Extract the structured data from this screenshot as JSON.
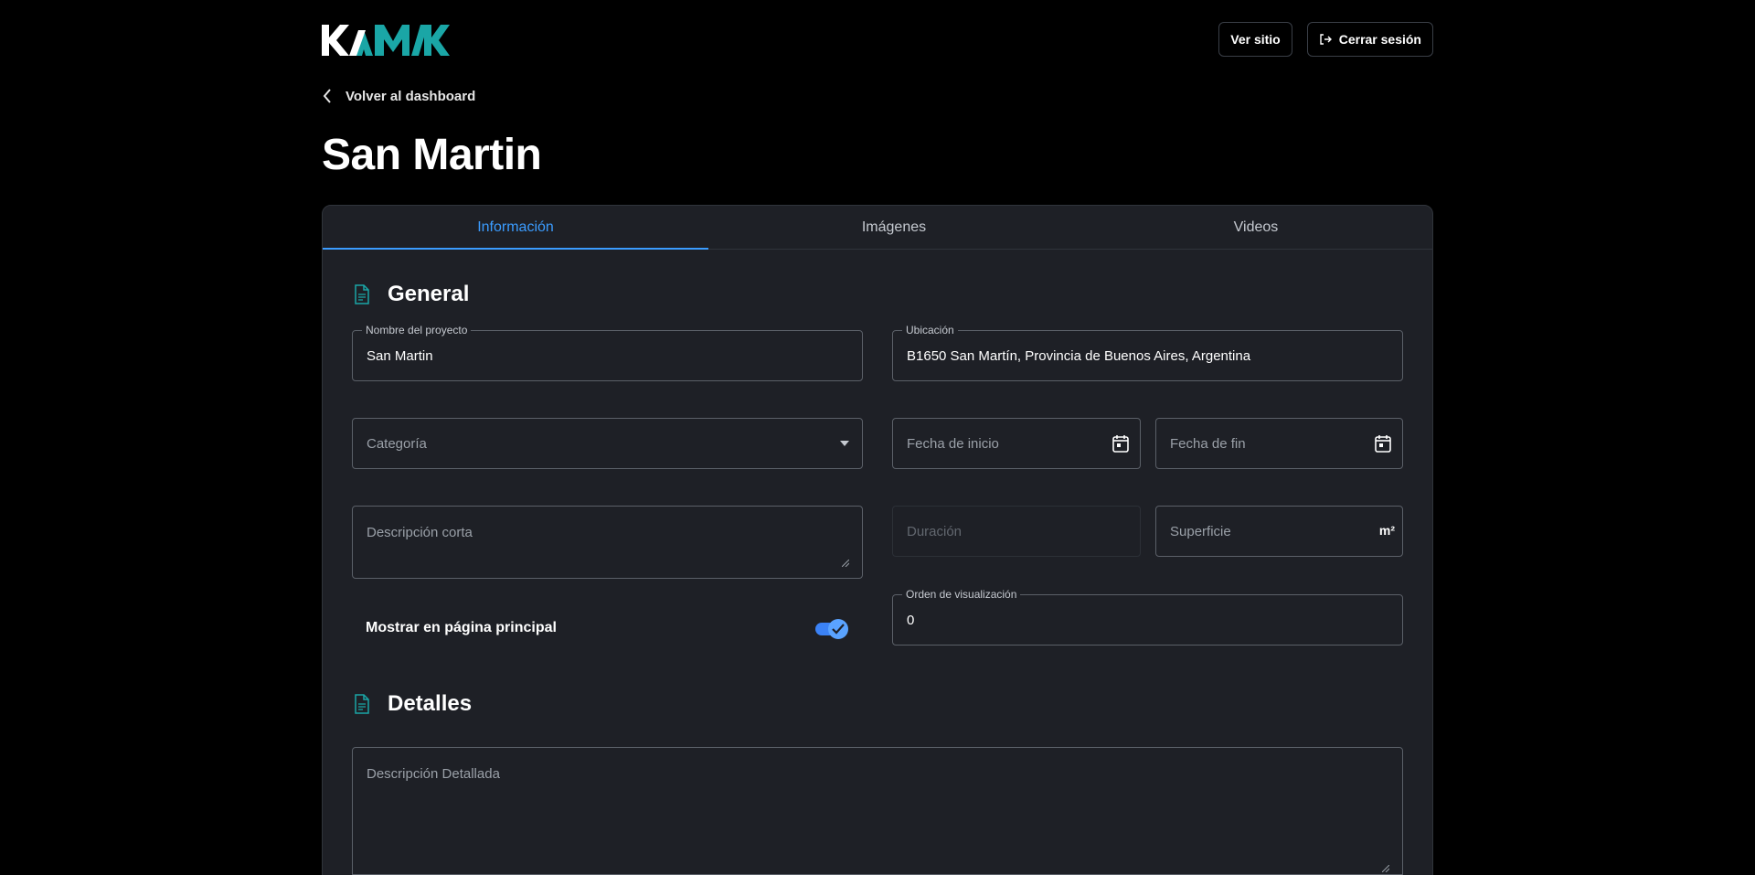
{
  "header": {
    "logo_text": "KAMAK",
    "view_site_label": "Ver sitio",
    "logout_label": "Cerrar sesión"
  },
  "back_link": {
    "label": "Volver al dashboard"
  },
  "page_title": "San Martin",
  "tabs": [
    {
      "label": "Información",
      "active": true
    },
    {
      "label": "Imágenes",
      "active": false
    },
    {
      "label": "Videos",
      "active": false
    }
  ],
  "sections": {
    "general": {
      "title": "General"
    },
    "details": {
      "title": "Detalles"
    }
  },
  "form": {
    "project_name": {
      "label": "Nombre del proyecto",
      "value": "San Martin"
    },
    "location": {
      "label": "Ubicación",
      "value": "B1650 San Martín, Provincia de Buenos Aires, Argentina"
    },
    "category": {
      "placeholder": "Categoría"
    },
    "start_date": {
      "placeholder": "Fecha de inicio"
    },
    "end_date": {
      "placeholder": "Fecha de fin"
    },
    "short_description": {
      "placeholder": "Descripción corta"
    },
    "duration": {
      "placeholder": "Duración",
      "disabled": true
    },
    "surface": {
      "placeholder": "Superficie",
      "unit": "m²"
    },
    "show_on_home": {
      "label": "Mostrar en página principal",
      "checked": true
    },
    "display_order": {
      "label": "Orden de visualización",
      "value": "0"
    },
    "detailed_description": {
      "placeholder": "Descripción Detallada"
    }
  },
  "colors": {
    "background": "#000000",
    "card": "#1e2026",
    "accent": "#3b9cff",
    "logo_white": "#ffffff",
    "logo_teal": "#1aa6a6"
  }
}
